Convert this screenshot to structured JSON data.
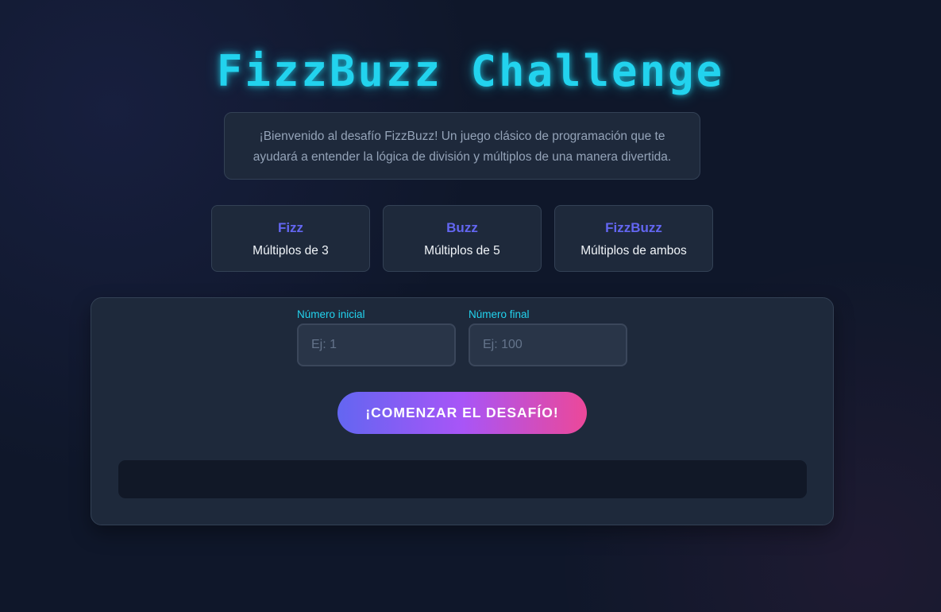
{
  "title": "FizzBuzz Challenge",
  "intro_text": "¡Bienvenido al desafío FizzBuzz! Un juego clásico de programación que te ayudará a entender la lógica de división y múltiplos de una manera divertida.",
  "rules": [
    {
      "name": "Fizz",
      "desc": "Múltiplos de 3"
    },
    {
      "name": "Buzz",
      "desc": "Múltiplos de 5"
    },
    {
      "name": "FizzBuzz",
      "desc": "Múltiplos de ambos"
    }
  ],
  "form": {
    "start": {
      "label": "Número inicial",
      "placeholder": "Ej: 1",
      "value": ""
    },
    "end": {
      "label": "Número final",
      "placeholder": "Ej: 100",
      "value": ""
    },
    "submit_label": "¡COMENZAR EL DESAFÍO!"
  },
  "result_text": "",
  "colors": {
    "background": "#0f172a",
    "card": "#1e293b",
    "accent_cyan": "#22d3ee",
    "accent_indigo": "#6366f1",
    "gradient_start": "#6366f1",
    "gradient_end": "#ec4899"
  }
}
